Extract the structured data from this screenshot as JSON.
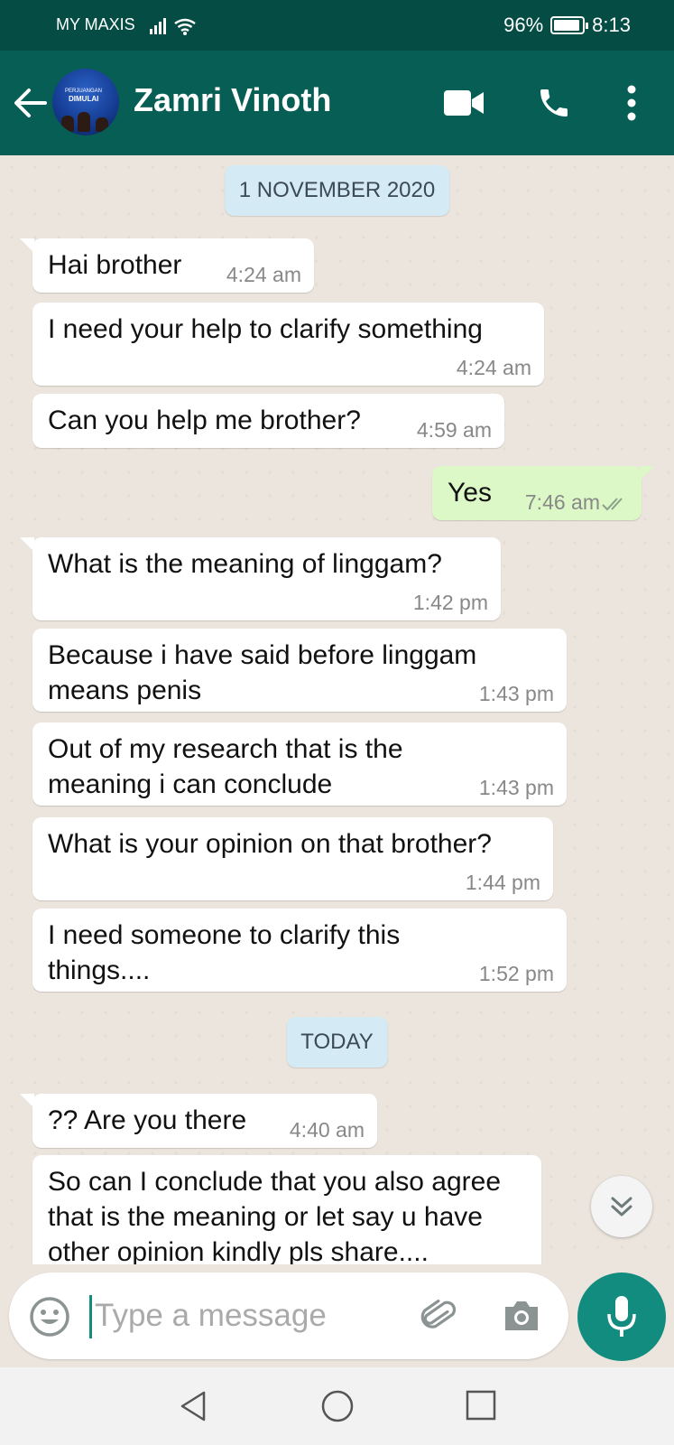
{
  "status_bar": {
    "carrier": "MY MAXIS",
    "battery": "96%",
    "time": "8:13"
  },
  "header": {
    "contact_name": "Zamri Vinoth",
    "avatar_text_1": "PERJUANGAN",
    "avatar_text_2": "DIMULAI"
  },
  "dates": {
    "first": "1 NOVEMBER 2020",
    "second": "TODAY"
  },
  "messages": [
    {
      "text": "Hai brother",
      "time": "4:24 am",
      "direction": "in"
    },
    {
      "text": "I need your help to clarify something",
      "time": "4:24 am",
      "direction": "in"
    },
    {
      "text": "Can you help me brother?",
      "time": "4:59 am",
      "direction": "in"
    },
    {
      "text": "Yes",
      "time": "7:46 am",
      "direction": "out",
      "status": "read"
    },
    {
      "text": "What is the meaning of linggam?",
      "time": "1:42 pm",
      "direction": "in"
    },
    {
      "text": "Because i have said before linggam means penis",
      "time": "1:43 pm",
      "direction": "in"
    },
    {
      "text": "Out of my research that is the meaning i can conclude",
      "time": "1:43 pm",
      "direction": "in"
    },
    {
      "text": "What is your opinion on that brother?",
      "time": "1:44 pm",
      "direction": "in"
    },
    {
      "text": "I need someone to clarify this things....",
      "time": "1:52 pm",
      "direction": "in"
    },
    {
      "text": "?? Are you there",
      "time": "4:40 am",
      "direction": "in"
    },
    {
      "text": "So can I conclude that you also agree that is the meaning or let say u have other opinion kindly pls share....",
      "time": "",
      "direction": "in"
    }
  ],
  "input": {
    "placeholder": "Type a message"
  },
  "icons": {
    "status": [
      "signal-icon",
      "wifi-icon",
      "battery-icon"
    ],
    "header": [
      "back-arrow-icon",
      "video-call-icon",
      "phone-icon",
      "more-options-icon"
    ],
    "input": [
      "emoji-icon",
      "attach-icon",
      "camera-icon",
      "mic-icon"
    ],
    "nav": [
      "nav-back-icon",
      "nav-home-icon",
      "nav-recents-icon"
    ]
  },
  "colors": {
    "header": "#075e54",
    "status_bar": "#054d44",
    "accent": "#128c7e",
    "outgoing_bubble": "#dcf8c6",
    "date_pill": "#d4eaf4",
    "chat_bg": "#ece5dd"
  }
}
